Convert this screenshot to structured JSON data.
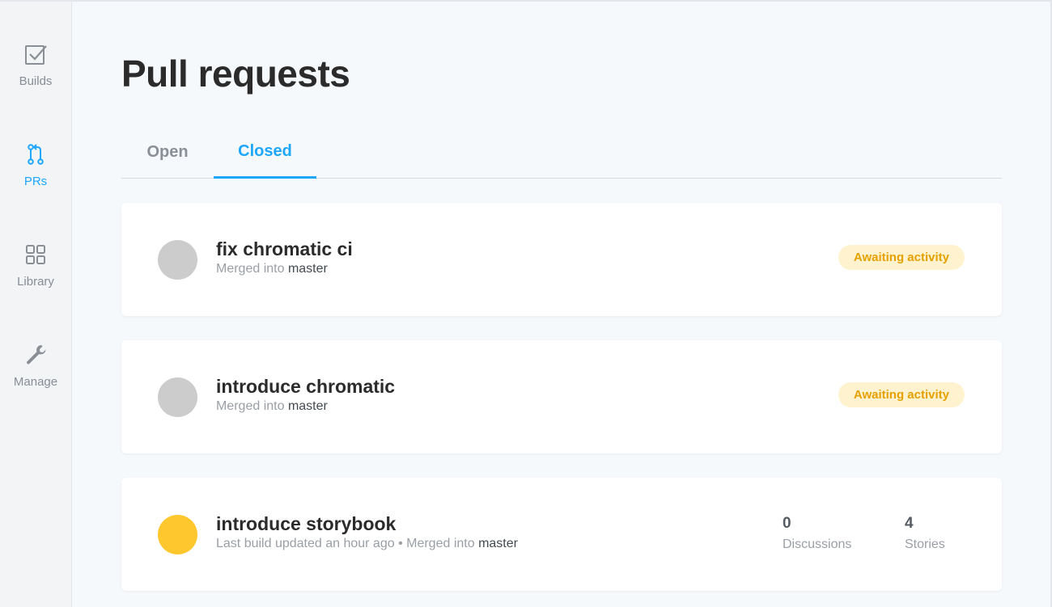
{
  "sidebar": {
    "items": [
      {
        "label": "Builds",
        "icon": "checkbox-icon",
        "active": false
      },
      {
        "label": "PRs",
        "icon": "pull-request-icon",
        "active": true
      },
      {
        "label": "Library",
        "icon": "grid-icon",
        "active": false
      },
      {
        "label": "Manage",
        "icon": "wrench-icon",
        "active": false
      }
    ]
  },
  "main": {
    "title": "Pull requests",
    "tabs": [
      {
        "label": "Open",
        "active": false
      },
      {
        "label": "Closed",
        "active": true
      }
    ],
    "pull_requests": [
      {
        "title": "fix chromatic ci",
        "prefix": "",
        "merged_text": "Merged into",
        "branch": "master",
        "status_color": "#cccccc",
        "badge": "Awaiting activity"
      },
      {
        "title": "introduce chromatic",
        "prefix": "",
        "merged_text": "Merged into",
        "branch": "master",
        "status_color": "#cccccc",
        "badge": "Awaiting activity"
      },
      {
        "title": "introduce storybook",
        "prefix": "Last build updated an hour ago • ",
        "merged_text": "Merged into",
        "branch": "master",
        "status_color": "#ffc72e",
        "discussions": {
          "value": "0",
          "label": "Discussions"
        },
        "stories": {
          "value": "4",
          "label": "Stories"
        }
      }
    ]
  },
  "colors": {
    "accent": "#1ea7fd",
    "badge_bg": "#fff3cf",
    "badge_text": "#e6a000"
  }
}
